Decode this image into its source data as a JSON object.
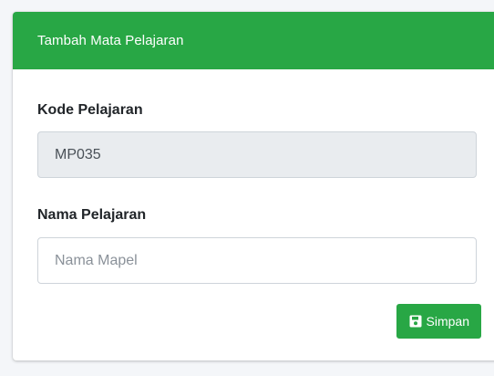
{
  "card": {
    "title": "Tambah Mata Pelajaran"
  },
  "form": {
    "kode": {
      "label": "Kode Pelajaran",
      "value": "MP035"
    },
    "nama": {
      "label": "Nama Pelajaran",
      "value": "",
      "placeholder": "Nama Mapel"
    },
    "save_button": {
      "label": "Simpan",
      "icon": "save-icon"
    }
  },
  "colors": {
    "header": "#28a745",
    "button": "#28a745",
    "readonly_bg": "#e9ecef"
  }
}
